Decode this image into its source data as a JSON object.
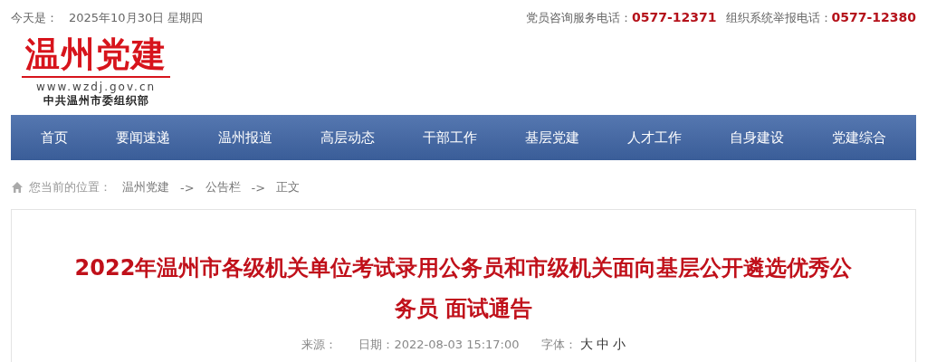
{
  "top_bar": {
    "date_label": "今天是：",
    "date": "2025年10月30日 星期四",
    "hotlines": [
      {
        "label": "党员咨询服务电话：",
        "number": "0577-12371"
      },
      {
        "label": "组织系统举报电话：",
        "number": "0577-12380"
      }
    ]
  },
  "logo": {
    "title": "温州党建",
    "url": "www.wzdj.gov.cn",
    "org": "中共温州市委组织部"
  },
  "nav": [
    "首页",
    "要闻速递",
    "温州报道",
    "高层动态",
    "干部工作",
    "基层党建",
    "人才工作",
    "自身建设",
    "党建综合"
  ],
  "breadcrumb": {
    "label": "您当前的位置：",
    "items": [
      "温州党建",
      "公告栏",
      "正文"
    ],
    "separator": "->"
  },
  "article": {
    "title": "2022年温州市各级机关单位考试录用公务员和市级机关面向基层公开遴选优秀公务员 面试通告",
    "source_label": "来源：",
    "date_label": "日期：",
    "date": "2022-08-03 15:17:00",
    "font_label": "字体：",
    "font_sizes": [
      "大",
      "中",
      "小"
    ]
  }
}
